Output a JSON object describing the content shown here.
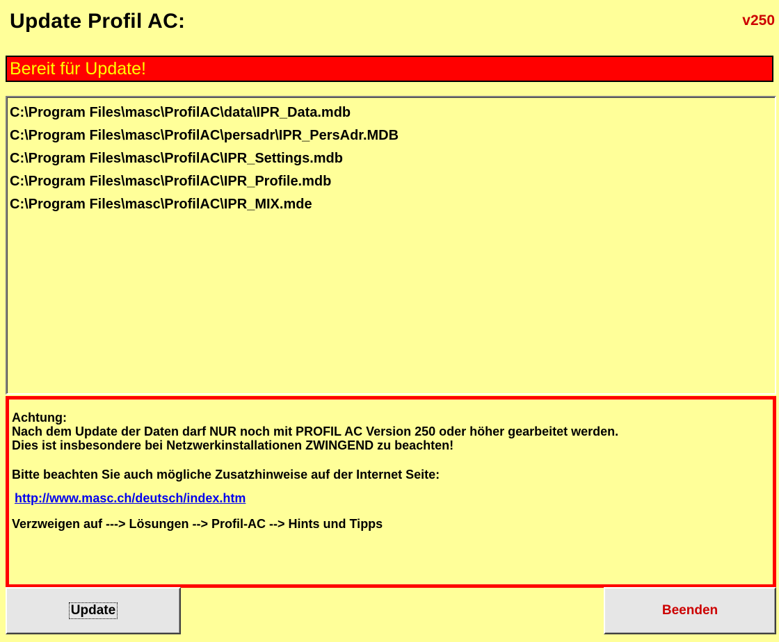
{
  "header": {
    "title": "Update Profil AC:",
    "version": "v250"
  },
  "status": {
    "text": "Bereit für Update!"
  },
  "files": [
    "C:\\Program Files\\masc\\ProfilAC\\data\\IPR_Data.mdb",
    "C:\\Program Files\\masc\\ProfilAC\\persadr\\IPR_PersAdr.MDB",
    "C:\\Program Files\\masc\\ProfilAC\\IPR_Settings.mdb",
    "C:\\Program Files\\masc\\ProfilAC\\IPR_Profile.mdb",
    "C:\\Program Files\\masc\\ProfilAC\\IPR_MIX.mde"
  ],
  "notice": {
    "heading": "Achtung:",
    "line1": "Nach dem Update der Daten darf NUR noch mit PROFIL AC Version 250 oder höher gearbeitet werden.",
    "line2": "Dies ist insbesondere bei Netzwerkinstallationen ZWINGEND zu beachten!",
    "line3": "Bitte beachten Sie auch mögliche Zusatzhinweise auf der Internet Seite:",
    "link": "http://www.masc.ch/deutsch/index.htm",
    "line4": "Verzweigen auf ---> Lösungen --> Profil-AC --> Hints und Tipps"
  },
  "buttons": {
    "update": "Update",
    "beenden": "Beenden"
  },
  "colors": {
    "background": "#ffff99",
    "status_bar": "#ff0000",
    "status_text": "#ffff00",
    "accent_red": "#cc0000",
    "link": "#0000ee"
  }
}
